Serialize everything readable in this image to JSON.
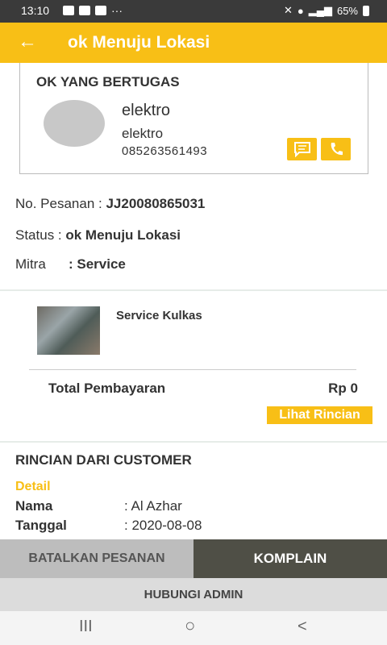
{
  "statusbar": {
    "time": "13:10",
    "battery": "65%"
  },
  "appbar": {
    "back": "←",
    "title": "ok Menuju Lokasi"
  },
  "card": {
    "title": "OK YANG BERTUGAS",
    "name": "elektro",
    "subname": "elektro",
    "phone": "085263561493"
  },
  "order": {
    "no_label": "No. Pesanan : ",
    "no_value": "JJ20080865031",
    "status_label": "Status : ",
    "status_value": "ok Menuju Lokasi",
    "mitra_label": "Mitra",
    "mitra_value": ": Service"
  },
  "service": {
    "name": "Service Kulkas"
  },
  "payment": {
    "label": "Total Pembayaran",
    "value": "Rp 0",
    "detail_link": "Lihat Rincian"
  },
  "customer": {
    "section_title": "RINCIAN DARI CUSTOMER",
    "detail_label": "Detail",
    "rows": [
      {
        "label": "Nama",
        "value": ":  Al Azhar"
      },
      {
        "label": "Tanggal",
        "value": ":  2020-08-08"
      }
    ]
  },
  "actions": {
    "cancel": "BATALKAN PESANAN",
    "complain": "KOMPLAIN",
    "contact_admin": "HUBUNGI ADMIN"
  },
  "nav": {
    "recent": "III",
    "home": "○",
    "back": "<"
  },
  "colors": {
    "accent": "#f8bf16",
    "dark_button": "#4f4f46"
  }
}
